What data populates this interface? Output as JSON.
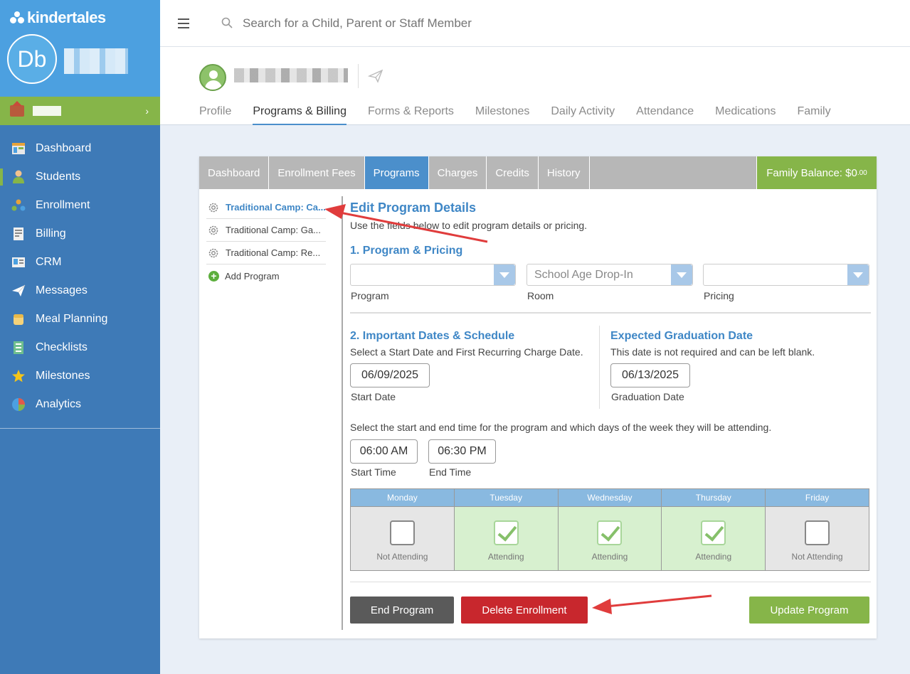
{
  "app": {
    "brand": "kindertales",
    "user_initials": "Db",
    "colors": {
      "sidebar": "#3e7ab7",
      "sidebar_top": "#4ca0e0",
      "accent_green": "#86b549",
      "accent_blue": "#4b8fcb",
      "danger": "#c8272d"
    }
  },
  "sidebar": {
    "items": [
      {
        "label": "Dashboard",
        "icon": "dashboard-icon"
      },
      {
        "label": "Students",
        "icon": "student-icon"
      },
      {
        "label": "Enrollment",
        "icon": "enrollment-icon"
      },
      {
        "label": "Billing",
        "icon": "billing-icon"
      },
      {
        "label": "CRM",
        "icon": "crm-icon"
      },
      {
        "label": "Messages",
        "icon": "paper-plane-icon"
      },
      {
        "label": "Meal Planning",
        "icon": "meal-icon"
      },
      {
        "label": "Checklists",
        "icon": "checklist-icon"
      },
      {
        "label": "Milestones",
        "icon": "star-icon"
      },
      {
        "label": "Analytics",
        "icon": "pie-chart-icon"
      }
    ]
  },
  "search": {
    "placeholder": "Search for a Child, Parent or Staff Member"
  },
  "profile_tabs": [
    "Profile",
    "Programs & Billing",
    "Forms & Reports",
    "Milestones",
    "Daily Activity",
    "Attendance",
    "Medications",
    "Family"
  ],
  "billing_tabs": [
    "Dashboard",
    "Enrollment Fees",
    "Programs",
    "Charges",
    "Credits",
    "History"
  ],
  "family_balance": {
    "label": "Family Balance: $0",
    "cents": ".00"
  },
  "programs_list": [
    "Traditional Camp: Ca...",
    "Traditional Camp: Ga...",
    "Traditional Camp: Re..."
  ],
  "add_program": "Add Program",
  "edit": {
    "title": "Edit Program Details",
    "desc": "Use the fields below to edit program details or pricing.",
    "section1": "1. Program & Pricing",
    "program": {
      "value": "",
      "label": "Program"
    },
    "room": {
      "value": "School Age Drop-In",
      "label": "Room"
    },
    "pricing": {
      "value": "",
      "label": "Pricing"
    },
    "section2": "2. Important Dates & Schedule",
    "section2_desc": "Select a Start Date and First Recurring Charge Date.",
    "start_date": "06/09/2025",
    "start_date_label": "Start Date",
    "grad_title": "Expected Graduation Date",
    "grad_desc": "This date is not required and can be left blank.",
    "grad_date": "06/13/2025",
    "grad_label": "Graduation Date",
    "time_desc": "Select the start and end time for the program and which days of the week they will be attending.",
    "start_time": "06:00 AM",
    "start_time_label": "Start Time",
    "end_time": "06:30 PM",
    "end_time_label": "End Time"
  },
  "days": [
    {
      "name": "Monday",
      "status": "Not Attending",
      "checked": false
    },
    {
      "name": "Tuesday",
      "status": "Attending",
      "checked": true
    },
    {
      "name": "Wednesday",
      "status": "Attending",
      "checked": true
    },
    {
      "name": "Thursday",
      "status": "Attending",
      "checked": true
    },
    {
      "name": "Friday",
      "status": "Not Attending",
      "checked": false
    }
  ],
  "buttons": {
    "end": "End Program",
    "delete": "Delete Enrollment",
    "update": "Update Program"
  }
}
